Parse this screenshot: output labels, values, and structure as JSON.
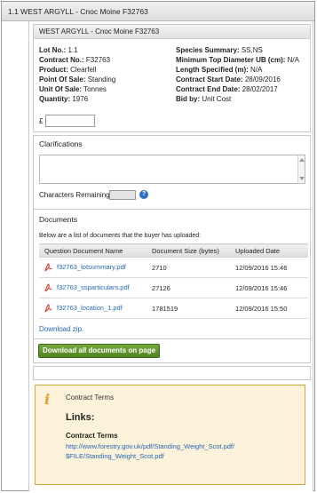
{
  "window": {
    "title": "1.1 WEST ARGYLL - Cnoc Moine F32763"
  },
  "lot": {
    "header": "WEST ARGYLL - Cnoc Moine F32763",
    "fields_left": [
      {
        "label": "Lot No.:",
        "value": "1.1"
      },
      {
        "label": "Contract No.:",
        "value": "F32763"
      },
      {
        "label": "Product:",
        "value": "Clearfell"
      },
      {
        "label": "Point Of Sale:",
        "value": "Standing"
      },
      {
        "label": "Unit Of Sale:",
        "value": "Tonnes"
      },
      {
        "label": "Quantity:",
        "value": "1976"
      }
    ],
    "fields_right": [
      {
        "label": "Species Summary:",
        "value": "SS,NS"
      },
      {
        "label": "Minimum Top Diameter UB (cm):",
        "value": "N/A"
      },
      {
        "label": "Length Specified (m):",
        "value": "N/A"
      },
      {
        "label": "Contract Start Date:",
        "value": "28/09/2016"
      },
      {
        "label": "Contract End Date:",
        "value": "28/02/2017"
      },
      {
        "label": "Bid by:",
        "value": "Unit Cost"
      }
    ],
    "currency_symbol": "£",
    "price_value": ""
  },
  "clarifications": {
    "title": "Clarifications",
    "text_value": "",
    "chars_label": "Characters Remaining:",
    "chars_value": "",
    "help_glyph": "?"
  },
  "documents": {
    "title": "Documents",
    "intro": "Below are a list of documents that the buyer has uploaded:",
    "columns": [
      "Question Document Name",
      "Document Size (bytes)",
      "Uploaded Date"
    ],
    "rows": [
      {
        "name": "f32763_lotsummary.pdf",
        "size": "2710",
        "date": "12/09/2016 15:46"
      },
      {
        "name": "f32763_ssparticulars.pdf",
        "size": "27126",
        "date": "12/09/2016 15:46"
      },
      {
        "name": "f32763_location_1.pdf",
        "size": "1781519",
        "date": "12/09/2016 15:50"
      }
    ],
    "zip_link": "Download zip."
  },
  "download_all_label": "Download all documents on page",
  "contract_terms": {
    "title": "Contract Terms",
    "links_heading": "Links:",
    "link_label": "Contract Terms",
    "url_line1": "http://www.forestry.gov.uk/pdf/Standing_Weight_Scot.pdf/",
    "url_line2": "$FILE/Standing_Weight_Scot.pdf",
    "info_glyph": "i"
  },
  "colors": {
    "link": "#2467b5",
    "button": "#5d9129",
    "notice_bg": "#fdf3da",
    "notice_border": "#e2a33a",
    "pdf_icon": "#d23a2a"
  },
  "icons": {
    "document": "pdf-icon",
    "help": "help-icon",
    "info": "info-icon"
  }
}
